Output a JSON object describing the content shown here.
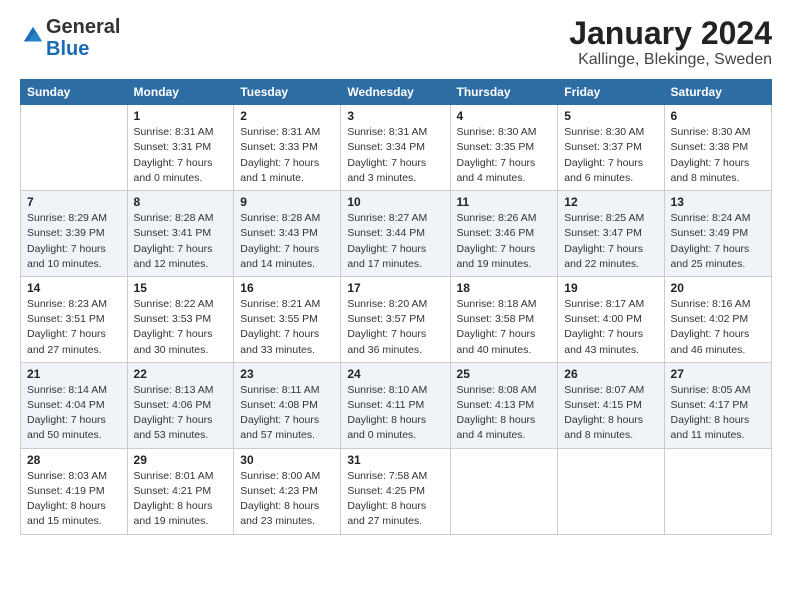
{
  "header": {
    "logo_general": "General",
    "logo_blue": "Blue",
    "title": "January 2024",
    "subtitle": "Kallinge, Blekinge, Sweden"
  },
  "days_of_week": [
    "Sunday",
    "Monday",
    "Tuesday",
    "Wednesday",
    "Thursday",
    "Friday",
    "Saturday"
  ],
  "weeks": [
    [
      {
        "day": "",
        "sunrise": "",
        "sunset": "",
        "daylight": ""
      },
      {
        "day": "1",
        "sunrise": "8:31 AM",
        "sunset": "3:31 PM",
        "daylight": "7 hours and 0 minutes."
      },
      {
        "day": "2",
        "sunrise": "8:31 AM",
        "sunset": "3:33 PM",
        "daylight": "7 hours and 1 minute."
      },
      {
        "day": "3",
        "sunrise": "8:31 AM",
        "sunset": "3:34 PM",
        "daylight": "7 hours and 3 minutes."
      },
      {
        "day": "4",
        "sunrise": "8:30 AM",
        "sunset": "3:35 PM",
        "daylight": "7 hours and 4 minutes."
      },
      {
        "day": "5",
        "sunrise": "8:30 AM",
        "sunset": "3:37 PM",
        "daylight": "7 hours and 6 minutes."
      },
      {
        "day": "6",
        "sunrise": "8:30 AM",
        "sunset": "3:38 PM",
        "daylight": "7 hours and 8 minutes."
      }
    ],
    [
      {
        "day": "7",
        "sunrise": "8:29 AM",
        "sunset": "3:39 PM",
        "daylight": "7 hours and 10 minutes."
      },
      {
        "day": "8",
        "sunrise": "8:28 AM",
        "sunset": "3:41 PM",
        "daylight": "7 hours and 12 minutes."
      },
      {
        "day": "9",
        "sunrise": "8:28 AM",
        "sunset": "3:43 PM",
        "daylight": "7 hours and 14 minutes."
      },
      {
        "day": "10",
        "sunrise": "8:27 AM",
        "sunset": "3:44 PM",
        "daylight": "7 hours and 17 minutes."
      },
      {
        "day": "11",
        "sunrise": "8:26 AM",
        "sunset": "3:46 PM",
        "daylight": "7 hours and 19 minutes."
      },
      {
        "day": "12",
        "sunrise": "8:25 AM",
        "sunset": "3:47 PM",
        "daylight": "7 hours and 22 minutes."
      },
      {
        "day": "13",
        "sunrise": "8:24 AM",
        "sunset": "3:49 PM",
        "daylight": "7 hours and 25 minutes."
      }
    ],
    [
      {
        "day": "14",
        "sunrise": "8:23 AM",
        "sunset": "3:51 PM",
        "daylight": "7 hours and 27 minutes."
      },
      {
        "day": "15",
        "sunrise": "8:22 AM",
        "sunset": "3:53 PM",
        "daylight": "7 hours and 30 minutes."
      },
      {
        "day": "16",
        "sunrise": "8:21 AM",
        "sunset": "3:55 PM",
        "daylight": "7 hours and 33 minutes."
      },
      {
        "day": "17",
        "sunrise": "8:20 AM",
        "sunset": "3:57 PM",
        "daylight": "7 hours and 36 minutes."
      },
      {
        "day": "18",
        "sunrise": "8:18 AM",
        "sunset": "3:58 PM",
        "daylight": "7 hours and 40 minutes."
      },
      {
        "day": "19",
        "sunrise": "8:17 AM",
        "sunset": "4:00 PM",
        "daylight": "7 hours and 43 minutes."
      },
      {
        "day": "20",
        "sunrise": "8:16 AM",
        "sunset": "4:02 PM",
        "daylight": "7 hours and 46 minutes."
      }
    ],
    [
      {
        "day": "21",
        "sunrise": "8:14 AM",
        "sunset": "4:04 PM",
        "daylight": "7 hours and 50 minutes."
      },
      {
        "day": "22",
        "sunrise": "8:13 AM",
        "sunset": "4:06 PM",
        "daylight": "7 hours and 53 minutes."
      },
      {
        "day": "23",
        "sunrise": "8:11 AM",
        "sunset": "4:08 PM",
        "daylight": "7 hours and 57 minutes."
      },
      {
        "day": "24",
        "sunrise": "8:10 AM",
        "sunset": "4:11 PM",
        "daylight": "8 hours and 0 minutes."
      },
      {
        "day": "25",
        "sunrise": "8:08 AM",
        "sunset": "4:13 PM",
        "daylight": "8 hours and 4 minutes."
      },
      {
        "day": "26",
        "sunrise": "8:07 AM",
        "sunset": "4:15 PM",
        "daylight": "8 hours and 8 minutes."
      },
      {
        "day": "27",
        "sunrise": "8:05 AM",
        "sunset": "4:17 PM",
        "daylight": "8 hours and 11 minutes."
      }
    ],
    [
      {
        "day": "28",
        "sunrise": "8:03 AM",
        "sunset": "4:19 PM",
        "daylight": "8 hours and 15 minutes."
      },
      {
        "day": "29",
        "sunrise": "8:01 AM",
        "sunset": "4:21 PM",
        "daylight": "8 hours and 19 minutes."
      },
      {
        "day": "30",
        "sunrise": "8:00 AM",
        "sunset": "4:23 PM",
        "daylight": "8 hours and 23 minutes."
      },
      {
        "day": "31",
        "sunrise": "7:58 AM",
        "sunset": "4:25 PM",
        "daylight": "8 hours and 27 minutes."
      },
      {
        "day": "",
        "sunrise": "",
        "sunset": "",
        "daylight": ""
      },
      {
        "day": "",
        "sunrise": "",
        "sunset": "",
        "daylight": ""
      },
      {
        "day": "",
        "sunrise": "",
        "sunset": "",
        "daylight": ""
      }
    ]
  ]
}
